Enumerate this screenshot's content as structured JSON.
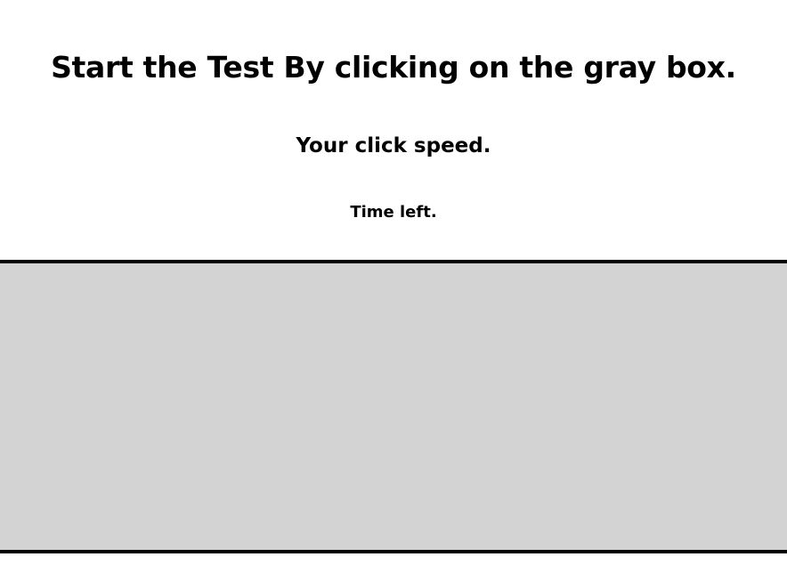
{
  "main_heading": "Start the Test By clicking on the gray box.",
  "click_speed_label": "Your click speed.",
  "time_left_label": "Time left.",
  "colors": {
    "background": "#ffffff",
    "click_box": "#d3d3d3",
    "click_box_border": "#000000",
    "text": "#000000"
  }
}
